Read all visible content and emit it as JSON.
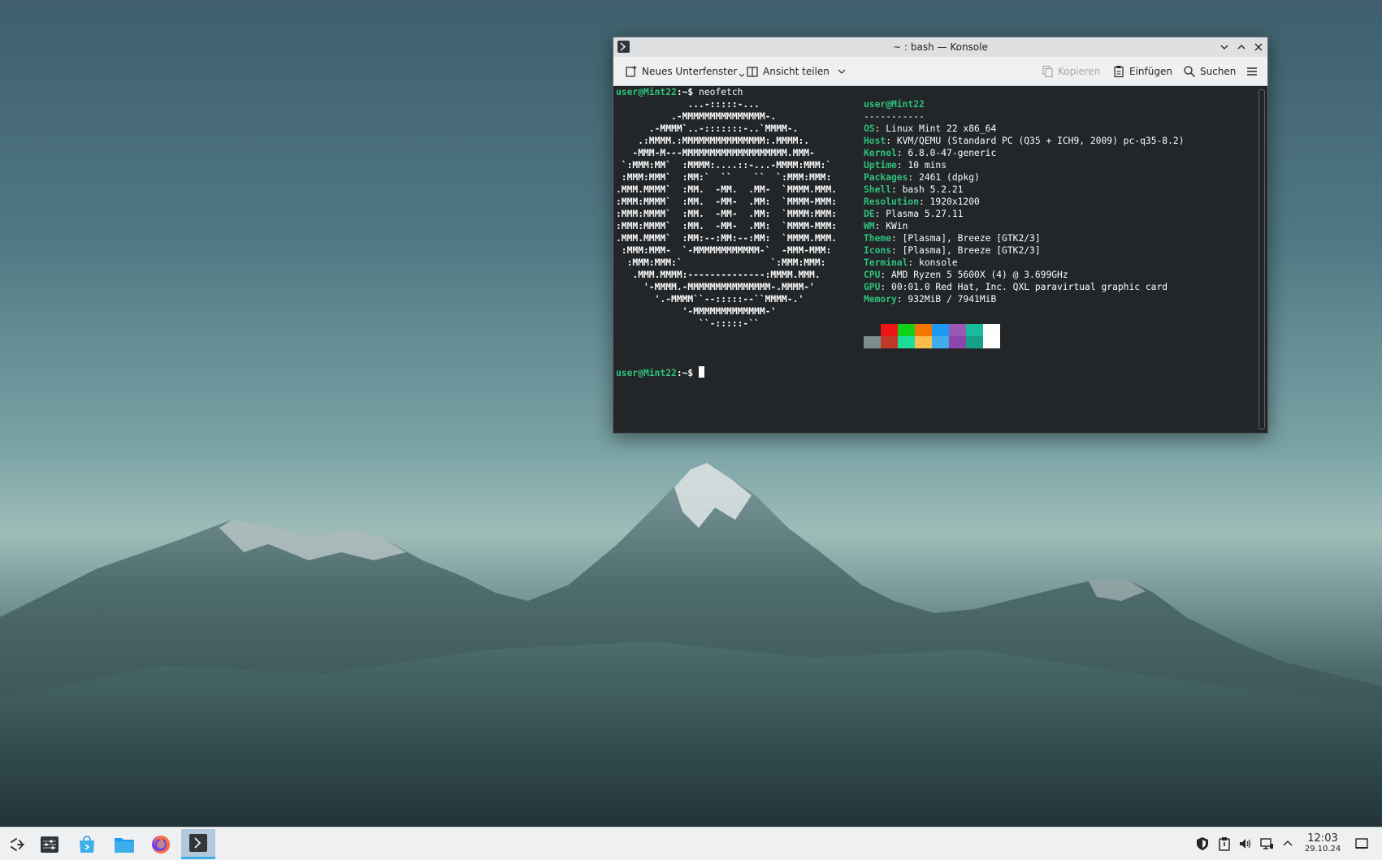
{
  "window": {
    "title": "~ : bash — Konsole"
  },
  "toolbar": {
    "new_tab": "Neues Unterfenster",
    "split_view": "Ansicht teilen",
    "copy": "Kopieren",
    "paste": "Einfügen",
    "search": "Suchen"
  },
  "terminal": {
    "prompt": "user@Mint22",
    "prompt_suffix": ":~$ ",
    "command": "neofetch",
    "ascii_logo": [
      "             ...-:::::-...",
      "          .-MMMMMMMMMMMMMMM-.",
      "      .-MMMM`..-:::::::-..`MMMM-.",
      "    .:MMMM.:MMMMMMMMMMMMMMM:.MMMM:.",
      "   -MMM-M---MMMMMMMMMMMMMMMMMMM.MMM-",
      " `:MMM:MM`  :MMMM:....::-...-MMMM:MMM:`",
      " :MMM:MMM`  :MM:`  ``    ``  `:MMM:MMM:",
      ".MMM.MMMM`  :MM.  -MM.  .MM-  `MMMM.MMM.",
      ":MMM:MMMM`  :MM.  -MM-  .MM:  `MMMM-MMM:",
      ":MMM:MMMM`  :MM.  -MM-  .MM:  `MMMM:MMM:",
      ":MMM:MMMM`  :MM.  -MM-  .MM:  `MMMM-MMM:",
      ".MMM.MMMM`  :MM:--:MM:--:MM:  `MMMM.MMM.",
      " :MMM:MMM-  `-MMMMMMMMMMMM-`  -MMM-MMM:",
      "  :MMM:MMM:`                `:MMM:MMM:",
      "   .MMM.MMMM:--------------:MMMM.MMM.",
      "     '-MMMM.-MMMMMMMMMMMMMMM-.MMMM-'",
      "       '.-MMMM``--:::::--``MMMM-.'",
      "            '-MMMMMMMMMMMMM-'",
      "               ``-:::::-``"
    ],
    "info_user": "user@Mint22",
    "info_separator": "-----------",
    "info": [
      {
        "key": "OS",
        "value": "Linux Mint 22 x86_64"
      },
      {
        "key": "Host",
        "value": "KVM/QEMU (Standard PC (Q35 + ICH9, 2009) pc-q35-8.2)"
      },
      {
        "key": "Kernel",
        "value": "6.8.0-47-generic"
      },
      {
        "key": "Uptime",
        "value": "10 mins"
      },
      {
        "key": "Packages",
        "value": "2461 (dpkg)"
      },
      {
        "key": "Shell",
        "value": "bash 5.2.21"
      },
      {
        "key": "Resolution",
        "value": "1920x1200"
      },
      {
        "key": "DE",
        "value": "Plasma 5.27.11"
      },
      {
        "key": "WM",
        "value": "KWin"
      },
      {
        "key": "Theme",
        "value": "[Plasma], Breeze [GTK2/3]"
      },
      {
        "key": "Icons",
        "value": "[Plasma], Breeze [GTK2/3]"
      },
      {
        "key": "Terminal",
        "value": "konsole"
      },
      {
        "key": "CPU",
        "value": "AMD Ryzen 5 5600X (4) @ 3.699GHz"
      },
      {
        "key": "GPU",
        "value": "00:01.0 Red Hat, Inc. QXL paravirtual graphic card"
      },
      {
        "key": "Memory",
        "value": "932MiB / 7941MiB"
      }
    ],
    "palette_top": [
      "#232629",
      "#ed1515",
      "#11d116",
      "#f67400",
      "#1d99f3",
      "#9b59b6",
      "#1abc9c",
      "#fcfcfc"
    ],
    "palette_bottom": [
      "#7f8c8d",
      "#c0392b",
      "#1cdc9a",
      "#fdbc4b",
      "#3daee9",
      "#8e44ad",
      "#16a085",
      "#ffffff"
    ]
  },
  "taskbar": {
    "apps": [
      "application-launcher-icon",
      "system-settings-icon",
      "discover-icon",
      "file-manager-icon",
      "firefox-icon",
      "konsole-icon"
    ],
    "clock_time": "12:03",
    "clock_date": "29.10.24"
  }
}
